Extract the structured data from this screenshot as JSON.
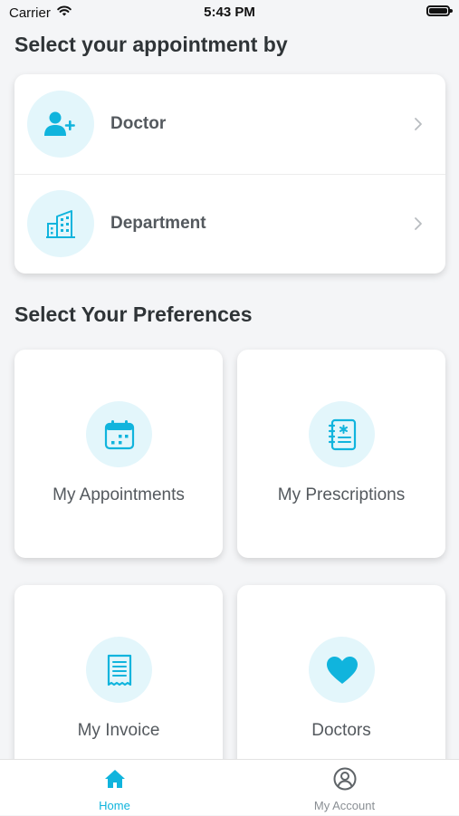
{
  "status_bar": {
    "carrier": "Carrier",
    "time": "5:43 PM"
  },
  "colors": {
    "accent": "#10b4dd",
    "icon_bg": "#e3f6fb",
    "text": "#2f3437",
    "muted": "#8a8f94"
  },
  "appointment_section": {
    "title": "Select your appointment by",
    "options": [
      {
        "label": "Doctor",
        "icon": "add-user-icon"
      },
      {
        "label": "Department",
        "icon": "building-icon"
      }
    ]
  },
  "preferences_section": {
    "title": "Select Your Preferences",
    "tiles": [
      {
        "label": "My Appointments",
        "icon": "calendar-icon"
      },
      {
        "label": "My Prescriptions",
        "icon": "prescription-notebook-icon"
      },
      {
        "label": "My Invoice",
        "icon": "invoice-receipt-icon"
      },
      {
        "label": "Doctors",
        "icon": "heart-icon"
      }
    ]
  },
  "tab_bar": {
    "tabs": [
      {
        "label": "Home",
        "icon": "home-icon",
        "active": true
      },
      {
        "label": "My Account",
        "icon": "user-circle-icon",
        "active": false
      }
    ]
  }
}
